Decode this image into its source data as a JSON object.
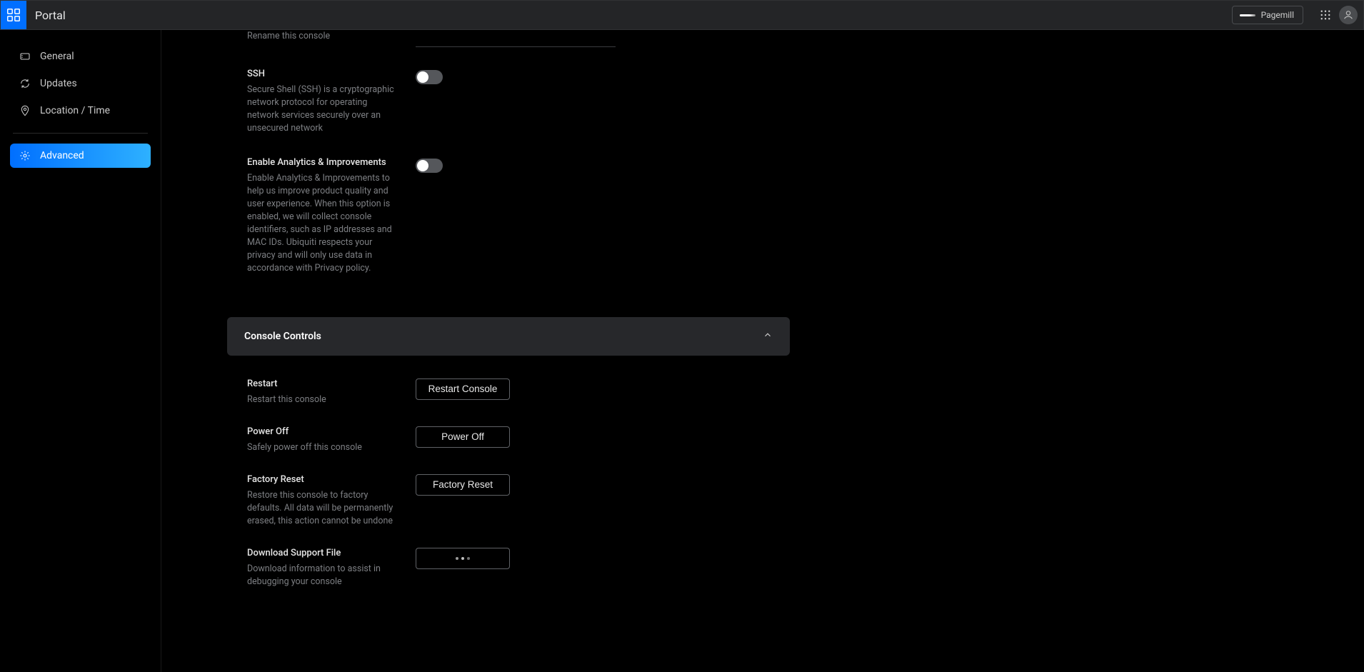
{
  "header": {
    "title": "Portal",
    "account_label": "Pagemill"
  },
  "sidebar": {
    "items": [
      {
        "label": "General"
      },
      {
        "label": "Updates"
      },
      {
        "label": "Location / Time"
      },
      {
        "label": "Advanced"
      }
    ]
  },
  "settings": {
    "rename_desc": "Rename this console",
    "ssh_title": "SSH",
    "ssh_desc": "Secure Shell (SSH) is a cryptographic network protocol for operating network services securely over an unsecured network",
    "analytics_title": "Enable Analytics & Improvements",
    "analytics_desc": "Enable Analytics & Improvements to help us improve product quality and user experience. When this option is enabled, we will collect console identifiers, such as IP addresses and MAC IDs. Ubiquiti respects your privacy and will only use data in accordance with Privacy policy."
  },
  "console_controls": {
    "section_title": "Console Controls",
    "restart_title": "Restart",
    "restart_desc": "Restart this console",
    "restart_button": "Restart Console",
    "poweroff_title": "Power Off",
    "poweroff_desc": "Safely power off this console",
    "poweroff_button": "Power Off",
    "factory_title": "Factory Reset",
    "factory_desc": "Restore this console to factory defaults. All data will be permanently erased, this action cannot be undone",
    "factory_button": "Factory Reset",
    "support_title": "Download Support File",
    "support_desc": "Download information to assist in debugging your console"
  }
}
